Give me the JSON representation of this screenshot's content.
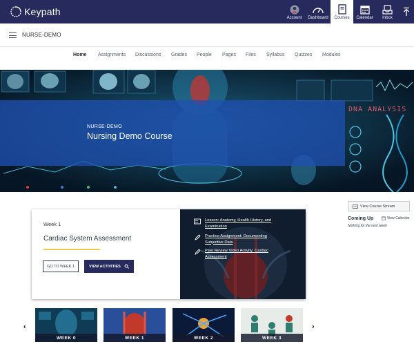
{
  "brand": {
    "name": "Keypath"
  },
  "global_nav": [
    {
      "key": "account",
      "label": "Account",
      "icon": "account-icon"
    },
    {
      "key": "dashboard",
      "label": "Dashboard",
      "icon": "dashboard-icon"
    },
    {
      "key": "courses",
      "label": "Courses",
      "icon": "courses-icon",
      "active": true
    },
    {
      "key": "calendar",
      "label": "Calendar",
      "icon": "calendar-icon"
    },
    {
      "key": "inbox",
      "label": "Inbox",
      "icon": "inbox-icon"
    }
  ],
  "breadcrumb": {
    "course_code": "NURSE-DEMO"
  },
  "course_nav": [
    "Home",
    "Assignments",
    "Discussions",
    "Grades",
    "People",
    "Pages",
    "Files",
    "Syllabus",
    "Quizzes",
    "Modules"
  ],
  "hero": {
    "subtitle": "NURSE-DEMO",
    "title": "Nursing Demo Course",
    "image_text": "DNA ANALYSIS"
  },
  "current_week": {
    "week_label": "Week 1",
    "title": "Cardiac System Assessment",
    "goto_button": "GO TO WEEK 1",
    "view_button": "VIEW ACTIVITIES",
    "activities": [
      {
        "icon": "lesson-icon",
        "text": "Lesson: Anatomy, Health History, and Examination"
      },
      {
        "icon": "assignment-icon",
        "text": "Practice Assignment: Documenting Subjective Data"
      },
      {
        "icon": "assignment-icon",
        "text": "Peer Review Video Activity: Cardiac Assessment"
      }
    ]
  },
  "sidebar": {
    "stream_button": "View Course Stream",
    "coming_up": "Coming Up",
    "view_calendar": "View Calendar",
    "nothing": "Nothing for the next week"
  },
  "weeks": [
    {
      "label": "WEEK 0"
    },
    {
      "label": "WEEK 1"
    },
    {
      "label": "WEEK 2"
    },
    {
      "label": "WEEK 3"
    }
  ],
  "colors": {
    "header_bg": "#262a5c",
    "hero_band": "#1f4faf",
    "accent_rule": "#f2c94c",
    "view_button_bg": "#262a5c"
  }
}
